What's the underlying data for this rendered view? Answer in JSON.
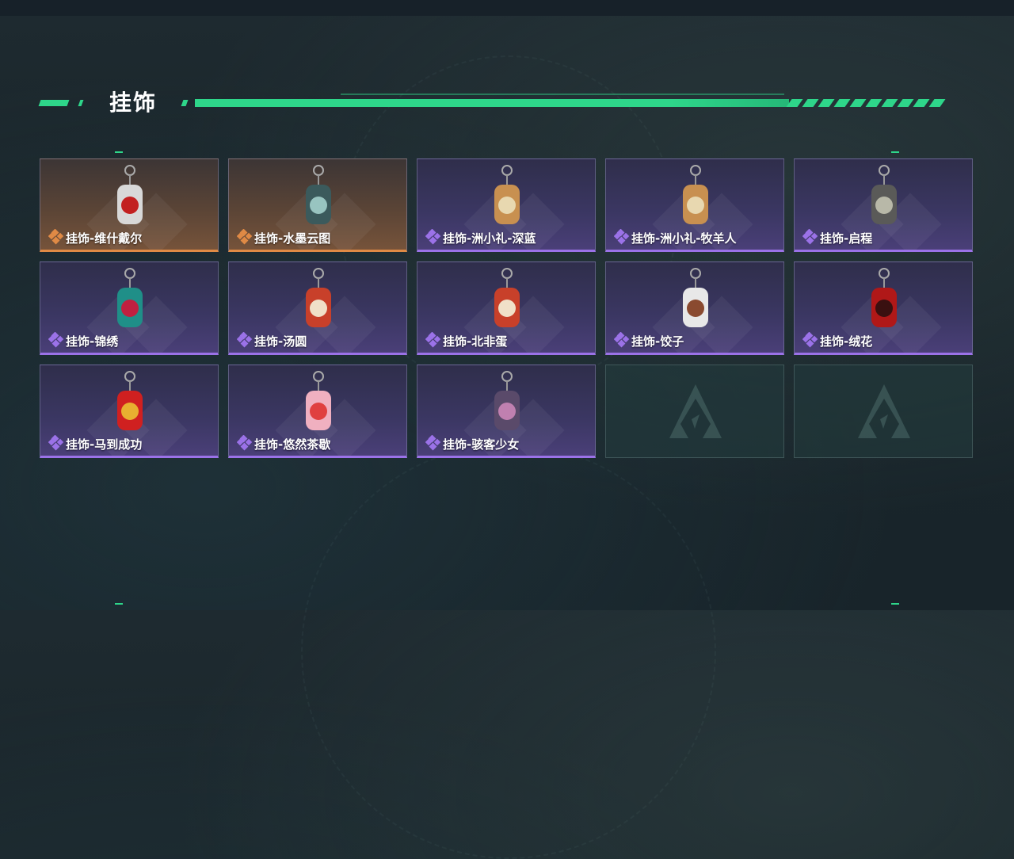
{
  "section": {
    "title": "挂饰"
  },
  "colors": {
    "accent": "#2ed68a",
    "rarity_purple": "#9b72e8",
    "rarity_orange": "#e08a45"
  },
  "items": [
    {
      "label": "挂饰-维什戴尔",
      "rarity": "orange",
      "icon": "keychain-red-can-icon"
    },
    {
      "label": "挂饰-水墨云图",
      "rarity": "orange",
      "icon": "keychain-cat-icon"
    },
    {
      "label": "挂饰-洲小礼-深蓝",
      "rarity": "purple",
      "icon": "keychain-box-character-icon"
    },
    {
      "label": "挂饰-洲小礼-牧羊人",
      "rarity": "purple",
      "icon": "keychain-box-character-icon"
    },
    {
      "label": "挂饰-启程",
      "rarity": "purple",
      "icon": "keychain-round-emblem-icon"
    },
    {
      "label": "挂饰-锦绣",
      "rarity": "purple",
      "icon": "keychain-butterfly-icon"
    },
    {
      "label": "挂饰-汤圆",
      "rarity": "purple",
      "icon": "keychain-bowl-icon"
    },
    {
      "label": "挂饰-北非蛋",
      "rarity": "purple",
      "icon": "keychain-bowl-icon"
    },
    {
      "label": "挂饰-饺子",
      "rarity": "purple",
      "icon": "keychain-dumplings-icon"
    },
    {
      "label": "挂饰-绒花",
      "rarity": "purple",
      "icon": "keychain-rose-icon"
    },
    {
      "label": "挂饰-马到成功",
      "rarity": "purple",
      "icon": "keychain-red-horse-icon"
    },
    {
      "label": "挂饰-悠然茶歇",
      "rarity": "purple",
      "icon": "keychain-cupcake-icon"
    },
    {
      "label": "挂饰-骇客少女",
      "rarity": "purple",
      "icon": "keychain-device-icon"
    }
  ],
  "empty_slots": 2
}
